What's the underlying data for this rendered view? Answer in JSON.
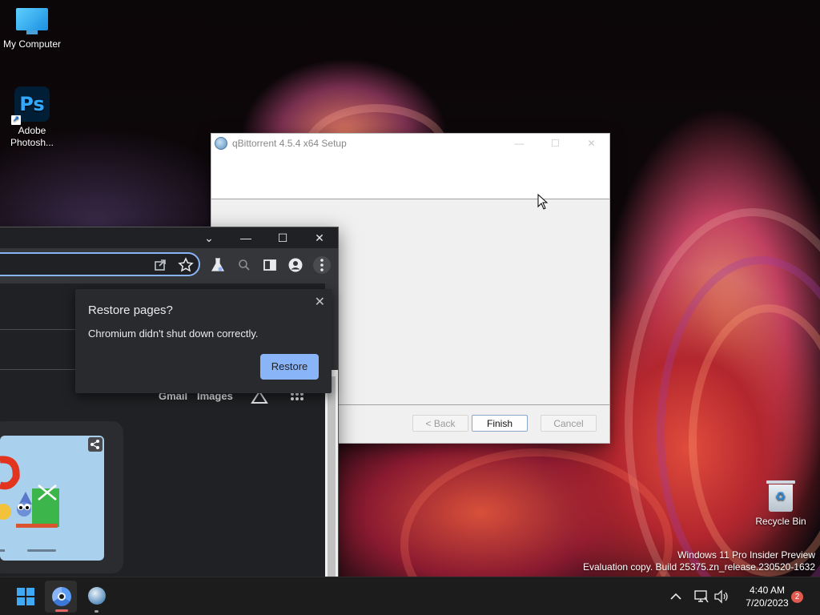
{
  "desktop": {
    "icons": [
      {
        "label": "My Computer"
      },
      {
        "label": "Adobe Photosh..."
      },
      {
        "label": "Recycle Bin"
      }
    ],
    "watermark": {
      "line1": "Windows 11 Pro Insider Preview",
      "line2": "Evaluation copy. Build 25375.zn_release.230520-1632"
    }
  },
  "setup_window": {
    "title": "qBittorrent 4.5.4 x64 Setup",
    "controls": {
      "minimize": "—",
      "maximize": "☐",
      "close": "✕"
    },
    "buttons": {
      "back": "< Back",
      "finish": "Finish",
      "cancel": "Cancel"
    }
  },
  "chromium": {
    "window_controls": {
      "tab_search": "⌄",
      "minimize": "—",
      "maximize": "☐",
      "close": "✕"
    },
    "toolbar_icons": [
      "share-icon",
      "star-icon",
      "labs-icon",
      "search-icon",
      "side-panel-icon",
      "profile-icon",
      "menu-icon"
    ],
    "page": {
      "gmail": "Gmail",
      "images": "Images"
    },
    "restore_popup": {
      "title": "Restore pages?",
      "message": "Chromium didn't shut down correctly.",
      "button": "Restore",
      "close": "✕"
    }
  },
  "taskbar": {
    "clock": {
      "time": "4:40 AM",
      "date": "7/20/2023"
    },
    "notification_count": "2",
    "tray_icons": [
      "chevron-up-icon",
      "network-icon",
      "volume-icon"
    ]
  },
  "colors": {
    "accent": "#8ab4f8",
    "chrome_dark": "#202124",
    "windows_blue": "#3fa9f5",
    "badge": "#e05a4e"
  }
}
